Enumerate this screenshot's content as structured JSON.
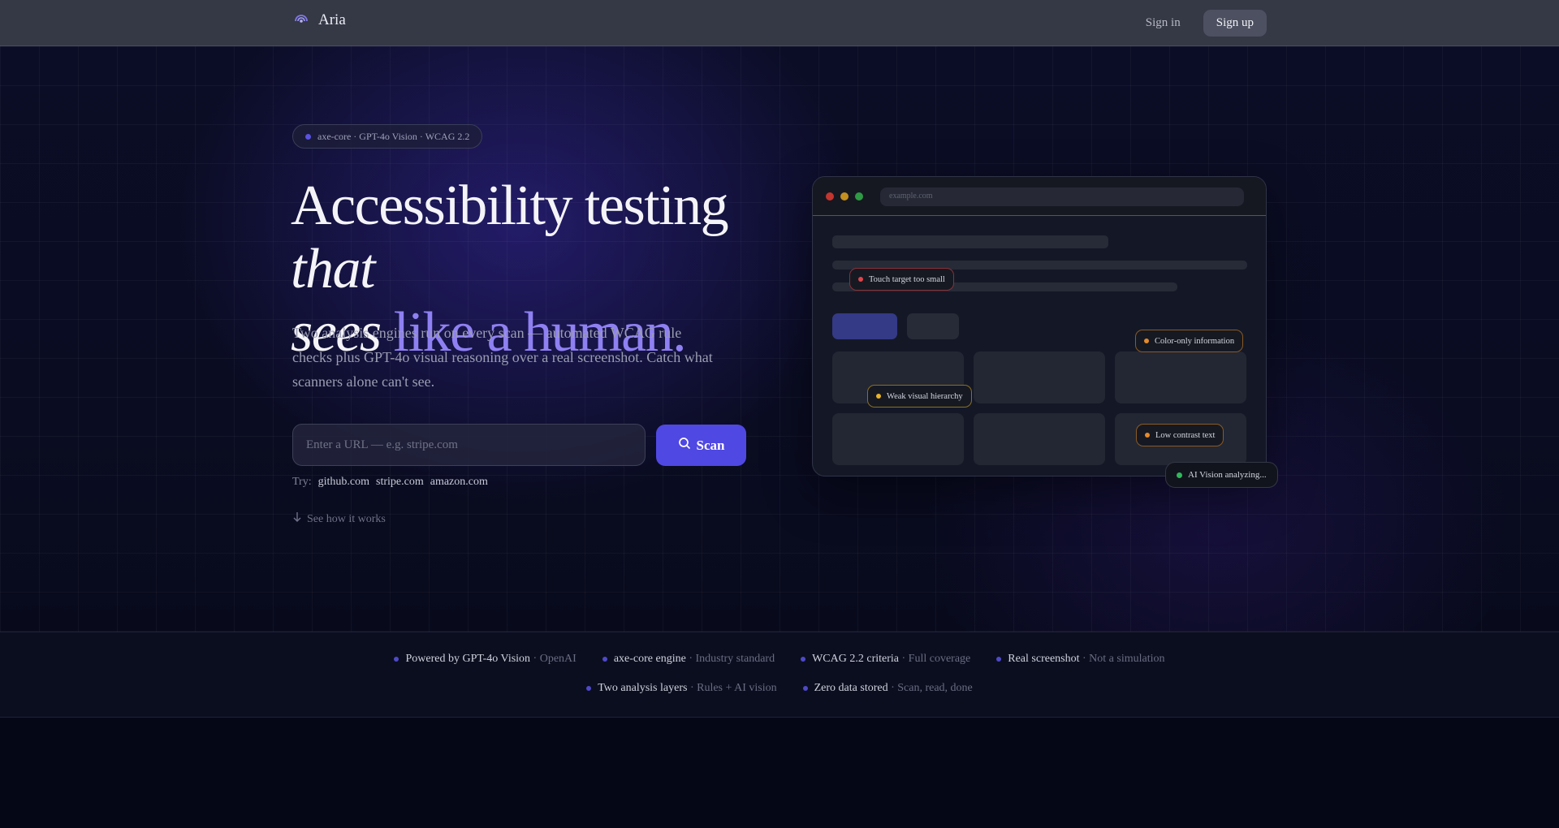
{
  "nav": {
    "brand": "Aria",
    "signin": "Sign in",
    "signup": "Sign up"
  },
  "hero": {
    "pill": "axe-core · GPT-4o Vision · WCAG 2.2",
    "headline_1": "Accessibility testing ",
    "headline_italic_1": "that",
    "headline_italic_2": "sees",
    "headline_accent": " like a human.",
    "subtitle": "Two analysis engines run on every scan — automated WCAG rule checks plus GPT-4o visual reasoning over a real screenshot. Catch what scanners alone can't see.",
    "input_placeholder": "Enter a URL — e.g. stripe.com",
    "scan_label": "Scan",
    "try_label": "Try:",
    "try_links": [
      "github.com",
      "stripe.com",
      "amazon.com"
    ],
    "how_it_works": "See how it works"
  },
  "mock": {
    "url": "example.com",
    "issues": [
      {
        "label": "Touch target too small",
        "color": "#e0444a"
      },
      {
        "label": "Color-only information",
        "color": "#e58a2b"
      },
      {
        "label": "Weak visual hierarchy",
        "color": "#e8b32a"
      },
      {
        "label": "Low contrast text",
        "color": "#e58a2b"
      }
    ],
    "status": "AI Vision analyzing..."
  },
  "features": [
    {
      "name": "Powered by GPT-4o Vision",
      "desc": " · OpenAI"
    },
    {
      "name": "axe-core engine",
      "desc": " · Industry standard"
    },
    {
      "name": "WCAG 2.2 criteria",
      "desc": " · Full coverage"
    },
    {
      "name": "Real screenshot",
      "desc": " · Not a simulation"
    },
    {
      "name": "Two analysis layers",
      "desc": " · Rules + AI vision"
    },
    {
      "name": "Zero data stored",
      "desc": " · Scan, read, done"
    }
  ],
  "colors": {
    "accent": "#5048e2",
    "accent_text": "#8f80f2"
  }
}
